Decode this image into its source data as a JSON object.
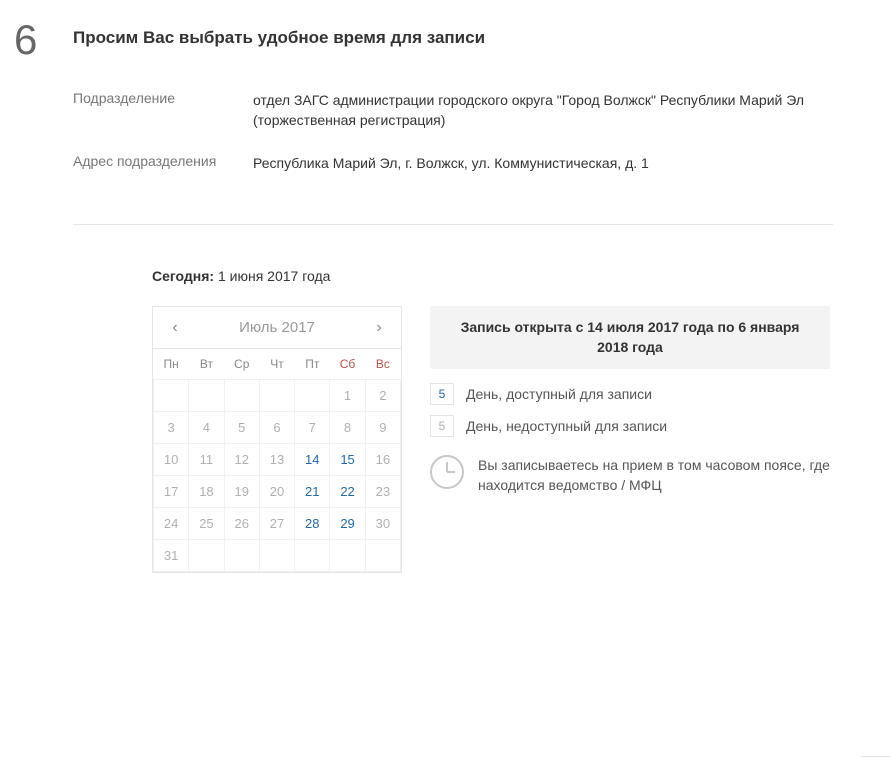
{
  "step": {
    "number": "6",
    "title": "Просим Вас выбрать удобное время для записи"
  },
  "info": {
    "department_label": "Подразделение",
    "department_value": "отдел ЗАГС администрации городского округа \"Город Волжск\" Республики Марий Эл (торжественная регистрация)",
    "address_label": "Адрес подразделения",
    "address_value": "Республика Марий Эл, г. Волжск, ул. Коммунистическая, д. 1"
  },
  "today": {
    "label": "Сегодня:",
    "value": "1 июня 2017 года"
  },
  "calendar": {
    "month": "Июль 2017",
    "weekdays": [
      "Пн",
      "Вт",
      "Ср",
      "Чт",
      "Пт",
      "Сб",
      "Вс"
    ],
    "weeks": [
      [
        {
          "d": "",
          "a": false
        },
        {
          "d": "",
          "a": false
        },
        {
          "d": "",
          "a": false
        },
        {
          "d": "",
          "a": false
        },
        {
          "d": "",
          "a": false
        },
        {
          "d": "1",
          "a": false
        },
        {
          "d": "2",
          "a": false
        }
      ],
      [
        {
          "d": "3",
          "a": false
        },
        {
          "d": "4",
          "a": false
        },
        {
          "d": "5",
          "a": false
        },
        {
          "d": "6",
          "a": false
        },
        {
          "d": "7",
          "a": false
        },
        {
          "d": "8",
          "a": false
        },
        {
          "d": "9",
          "a": false
        }
      ],
      [
        {
          "d": "10",
          "a": false
        },
        {
          "d": "11",
          "a": false
        },
        {
          "d": "12",
          "a": false
        },
        {
          "d": "13",
          "a": false
        },
        {
          "d": "14",
          "a": true
        },
        {
          "d": "15",
          "a": true
        },
        {
          "d": "16",
          "a": false
        }
      ],
      [
        {
          "d": "17",
          "a": false
        },
        {
          "d": "18",
          "a": false
        },
        {
          "d": "19",
          "a": false
        },
        {
          "d": "20",
          "a": false
        },
        {
          "d": "21",
          "a": true
        },
        {
          "d": "22",
          "a": true
        },
        {
          "d": "23",
          "a": false
        }
      ],
      [
        {
          "d": "24",
          "a": false
        },
        {
          "d": "25",
          "a": false
        },
        {
          "d": "26",
          "a": false
        },
        {
          "d": "27",
          "a": false
        },
        {
          "d": "28",
          "a": true
        },
        {
          "d": "29",
          "a": true
        },
        {
          "d": "30",
          "a": false
        }
      ],
      [
        {
          "d": "31",
          "a": false
        },
        {
          "d": "",
          "a": false
        },
        {
          "d": "",
          "a": false
        },
        {
          "d": "",
          "a": false
        },
        {
          "d": "",
          "a": false
        },
        {
          "d": "",
          "a": false
        },
        {
          "d": "",
          "a": false
        }
      ]
    ]
  },
  "legend": {
    "banner": "Запись открыта с 14 июля 2017 года по 6 января 2018 года",
    "sample_day": "5",
    "available": "День, доступный для записи",
    "unavailable": "День, недоступный для записи",
    "tz_note": "Вы записываетесь на прием в том часовом поясе, где находится ведомство / МФЦ"
  }
}
